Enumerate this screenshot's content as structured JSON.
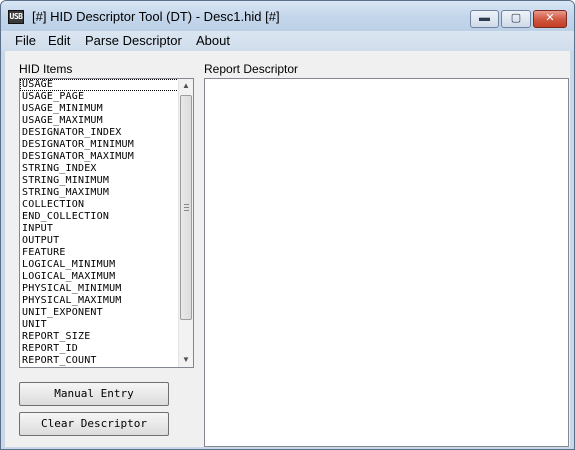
{
  "window": {
    "title": "[#] HID Descriptor Tool (DT) - Desc1.hid [#]",
    "icon_text": "USB",
    "controls": {
      "minimize": "▬",
      "maximize": "▢",
      "close": "✕"
    }
  },
  "menu": {
    "file": "File",
    "edit": "Edit",
    "parse": "Parse Descriptor",
    "about": "About"
  },
  "hid_items": {
    "label": "HID Items",
    "items": [
      "USAGE",
      "USAGE_PAGE",
      "USAGE_MINIMUM",
      "USAGE_MAXIMUM",
      "DESIGNATOR_INDEX",
      "DESIGNATOR_MINIMUM",
      "DESIGNATOR_MAXIMUM",
      "STRING_INDEX",
      "STRING_MINIMUM",
      "STRING_MAXIMUM",
      "COLLECTION",
      "END_COLLECTION",
      "INPUT",
      "OUTPUT",
      "FEATURE",
      "LOGICAL_MINIMUM",
      "LOGICAL_MAXIMUM",
      "PHYSICAL_MINIMUM",
      "PHYSICAL_MAXIMUM",
      "UNIT_EXPONENT",
      "UNIT",
      "REPORT_SIZE",
      "REPORT_ID",
      "REPORT_COUNT"
    ],
    "selected": "USAGE"
  },
  "buttons": {
    "manual_entry": "Manual Entry",
    "clear_descriptor": "Clear Descriptor"
  },
  "report": {
    "label": "Report Descriptor"
  },
  "scrollbar": {
    "up": "▲",
    "down": "▼"
  }
}
